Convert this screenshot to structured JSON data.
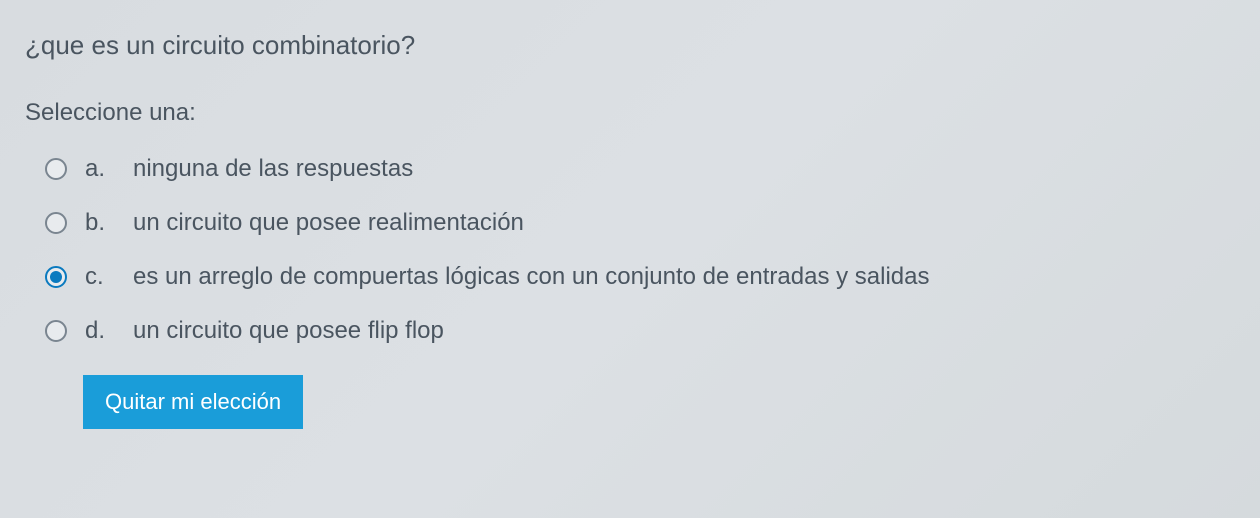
{
  "question": {
    "text": "¿que es un circuito combinatorio?",
    "instruction": "Seleccione una:",
    "options": [
      {
        "letter": "a.",
        "text": "ninguna de las respuestas",
        "selected": false
      },
      {
        "letter": "b.",
        "text": "un circuito que posee realimentación",
        "selected": false
      },
      {
        "letter": "c.",
        "text": "es un arreglo de compuertas lógicas con un conjunto de entradas y salidas",
        "selected": true
      },
      {
        "letter": "d.",
        "text": "un circuito que posee flip flop",
        "selected": false
      }
    ],
    "clear_label": "Quitar mi elección"
  }
}
